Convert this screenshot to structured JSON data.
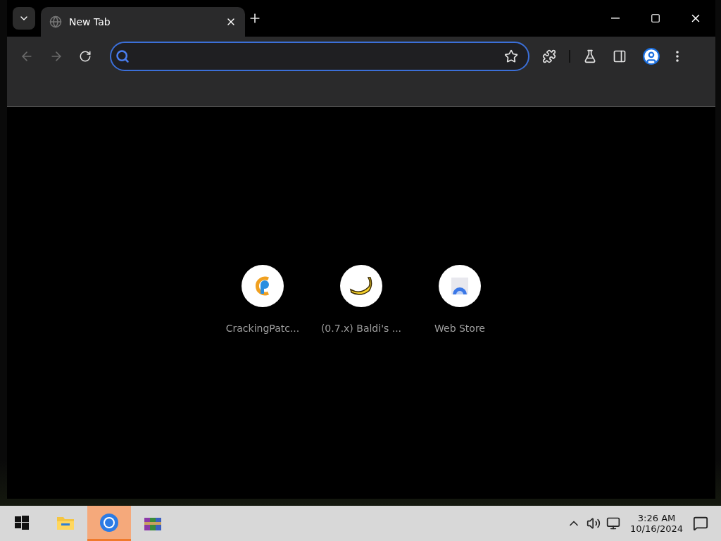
{
  "tabs": [
    {
      "title": "New Tab",
      "selected": true
    }
  ],
  "toolbar": {
    "back": {
      "disabled": true
    },
    "forward": {
      "disabled": true
    },
    "omnibox": {
      "focused": true
    }
  },
  "shortcuts": [
    {
      "title": "CrackingPatc...",
      "kind": "cp"
    },
    {
      "title": "(0.7.x) Baldi's ...",
      "kind": "banana"
    },
    {
      "title": "Web Store",
      "kind": "store"
    }
  ],
  "taskbar": {
    "apps": [
      {
        "kind": "explorer",
        "selected": false
      },
      {
        "kind": "chrome",
        "selected": true
      },
      {
        "kind": "archiver",
        "selected": false
      }
    ],
    "time": "3:26 AM",
    "date": "10/16/2024"
  }
}
